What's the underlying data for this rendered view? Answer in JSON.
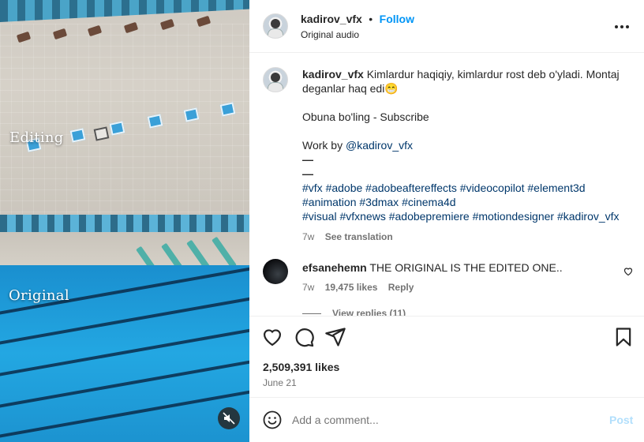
{
  "media": {
    "top_label": "Editing",
    "bottom_label": "Original",
    "mute_icon": "speaker-muted-icon"
  },
  "header": {
    "username": "kadirov_vfx",
    "separator": "•",
    "follow_label": "Follow",
    "audio": "Original audio",
    "more_icon": "more-options-icon"
  },
  "caption": {
    "username": "kadirov_vfx",
    "text_line1": "Kimlardur haqiqiy, kimlardur rost deb o'yladi. Montaj",
    "text_line2": "deganlar haq edi😁",
    "subscribe": "Obuna bo'ling - Subscribe",
    "work_by_prefix": "Work by ",
    "work_by_mention": "@kadirov_vfx",
    "dash1": "—",
    "dash2": "—",
    "hashtags_line1": "#vfx #adobe #adobeaftereffects #videocopilot #element3d",
    "hashtags_line2": "#animation #3dmax #cinema4d",
    "hashtags_line3": "#visual #vfxnews #adobepremiere #motiondesigner #kadirov_vfx",
    "time": "7w",
    "see_translation": "See translation"
  },
  "comment": {
    "username": "efsanehemn",
    "text": "THE ORIGINAL IS THE EDITED ONE..",
    "time": "7w",
    "likes": "19,475 likes",
    "reply": "Reply",
    "view_replies": "View replies (11)"
  },
  "actions": {
    "likes": "2,509,391 likes",
    "date": "June 21"
  },
  "add_comment": {
    "placeholder": "Add a comment...",
    "post_label": "Post"
  },
  "colors": {
    "accent": "#0095f6",
    "link": "#00376b",
    "muted": "#737373"
  }
}
